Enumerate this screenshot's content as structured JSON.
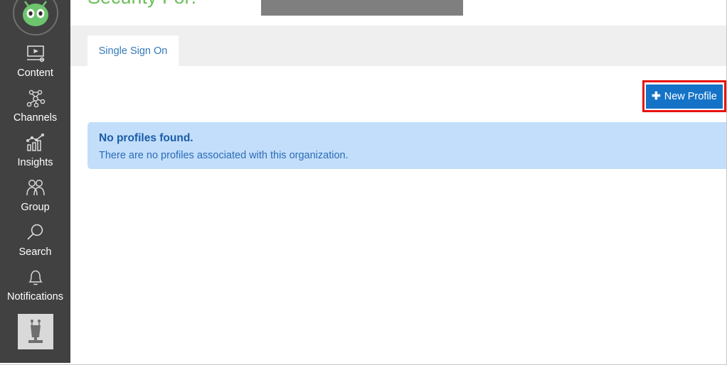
{
  "header": {
    "title": "Security For:",
    "title_color": "#6bbf59",
    "redaction_label": "redacted-organization-name"
  },
  "sidebar": {
    "background_color": "#414141",
    "logo": {
      "name": "app-logo",
      "alt": "green alien mascot face"
    },
    "items": [
      {
        "label": "Content",
        "icon": "video-player-icon"
      },
      {
        "label": "Channels",
        "icon": "network-nodes-icon"
      },
      {
        "label": "Insights",
        "icon": "bar-chart-trend-icon"
      },
      {
        "label": "Group",
        "icon": "people-group-icon"
      },
      {
        "label": "Search",
        "icon": "magnifier-icon"
      },
      {
        "label": "Notifications",
        "icon": "bell-icon"
      }
    ],
    "avatar": {
      "name": "user-avatar",
      "alt": "robot avatar"
    }
  },
  "tabs": [
    {
      "label": "Single Sign On",
      "active": true,
      "color": "#337ab7"
    }
  ],
  "toolbar": {
    "new_profile_label": "New Profile",
    "new_profile_icon": "plus-icon",
    "new_profile_color": "#1473c6",
    "highlight_color": "#e8120e"
  },
  "alert": {
    "title": "No profiles found.",
    "body": "There are no profiles associated with this organization.",
    "background_color": "#c3defa",
    "text_color": "#1a5ca8"
  }
}
